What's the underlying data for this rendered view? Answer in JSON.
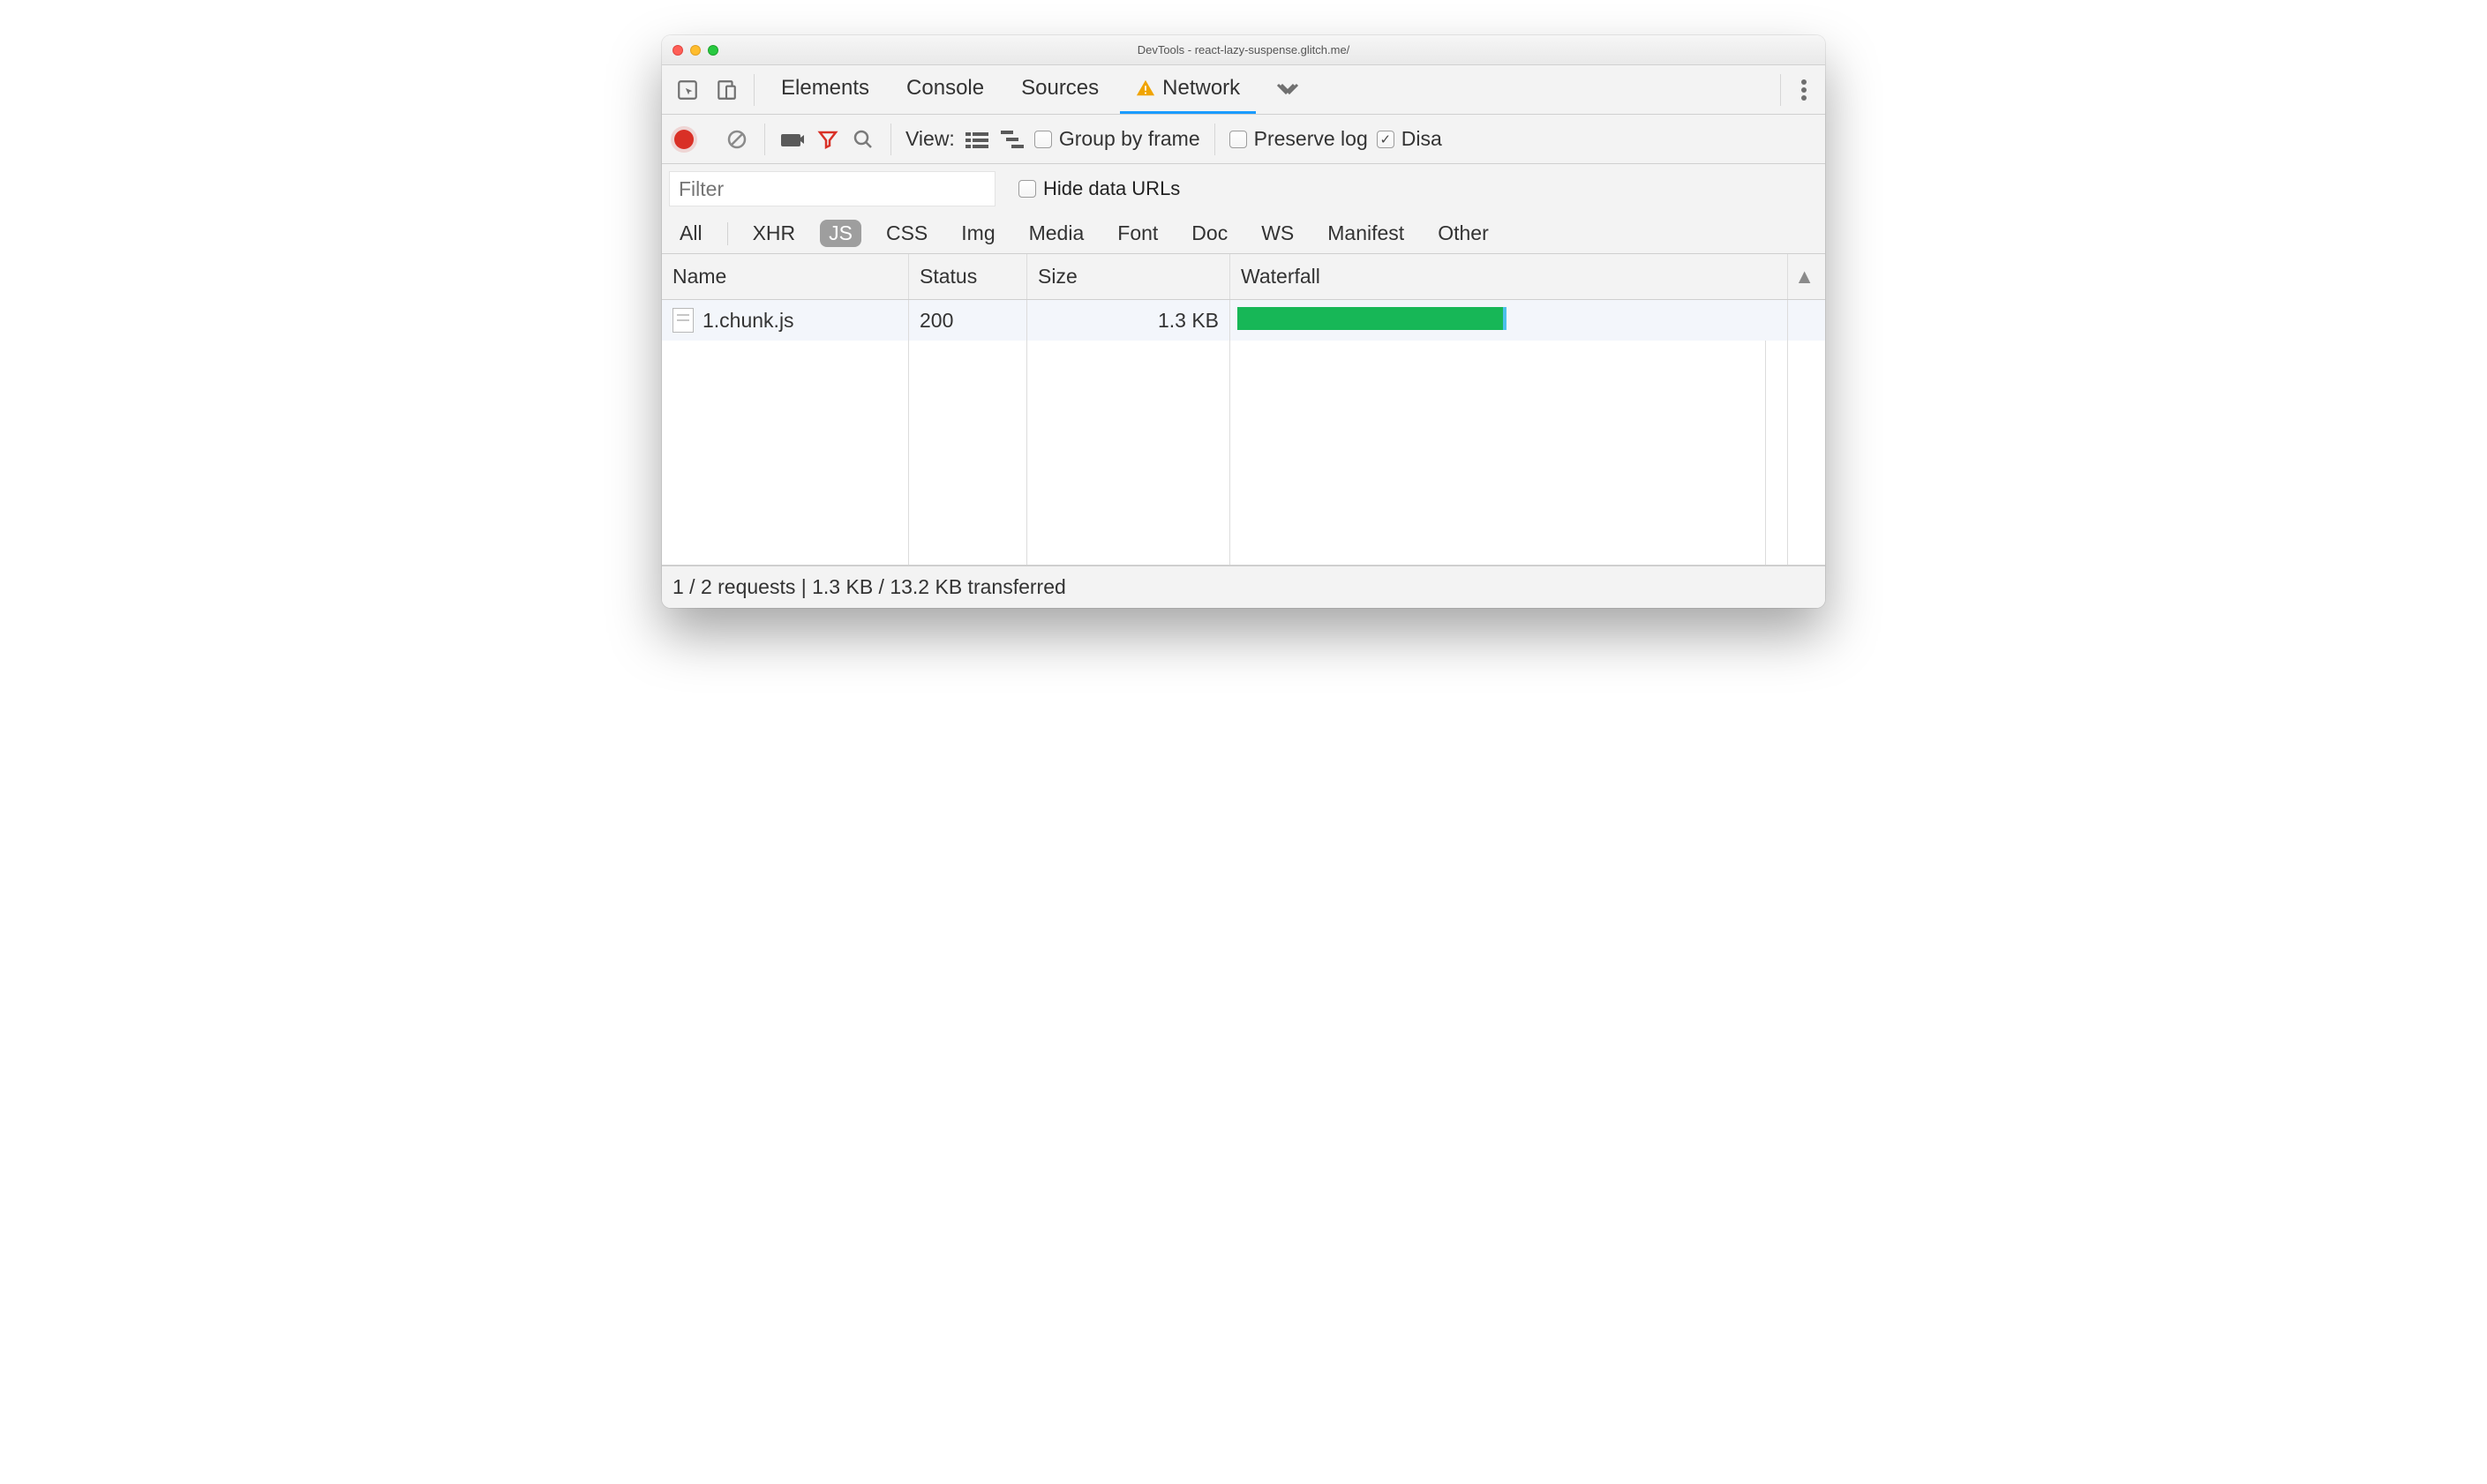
{
  "titlebar": {
    "title": "DevTools - react-lazy-suspense.glitch.me/"
  },
  "tabs": {
    "items": [
      "Elements",
      "Console",
      "Sources",
      "Network"
    ],
    "active_index": 3,
    "warning_on_index": 3
  },
  "toolbar": {
    "view_label": "View:",
    "group_by_frame": "Group by frame",
    "preserve_log": "Preserve log",
    "disable_cache": "Disa",
    "preserve_checked": false,
    "disable_checked": true,
    "group_checked": false
  },
  "filter": {
    "placeholder": "Filter",
    "hide_data_urls": "Hide data URLs",
    "hide_checked": false
  },
  "type_filters": {
    "items": [
      "All",
      "XHR",
      "JS",
      "CSS",
      "Img",
      "Media",
      "Font",
      "Doc",
      "WS",
      "Manifest",
      "Other"
    ],
    "active_index": 2
  },
  "table": {
    "columns": [
      "Name",
      "Status",
      "Size",
      "Waterfall"
    ],
    "rows": [
      {
        "name": "1.chunk.js",
        "status": "200",
        "size": "1.3 KB",
        "bar_start_pct": 0,
        "bar_width_pct": 49
      }
    ]
  },
  "status": {
    "text": "1 / 2 requests | 1.3 KB / 13.2 KB transferred"
  }
}
